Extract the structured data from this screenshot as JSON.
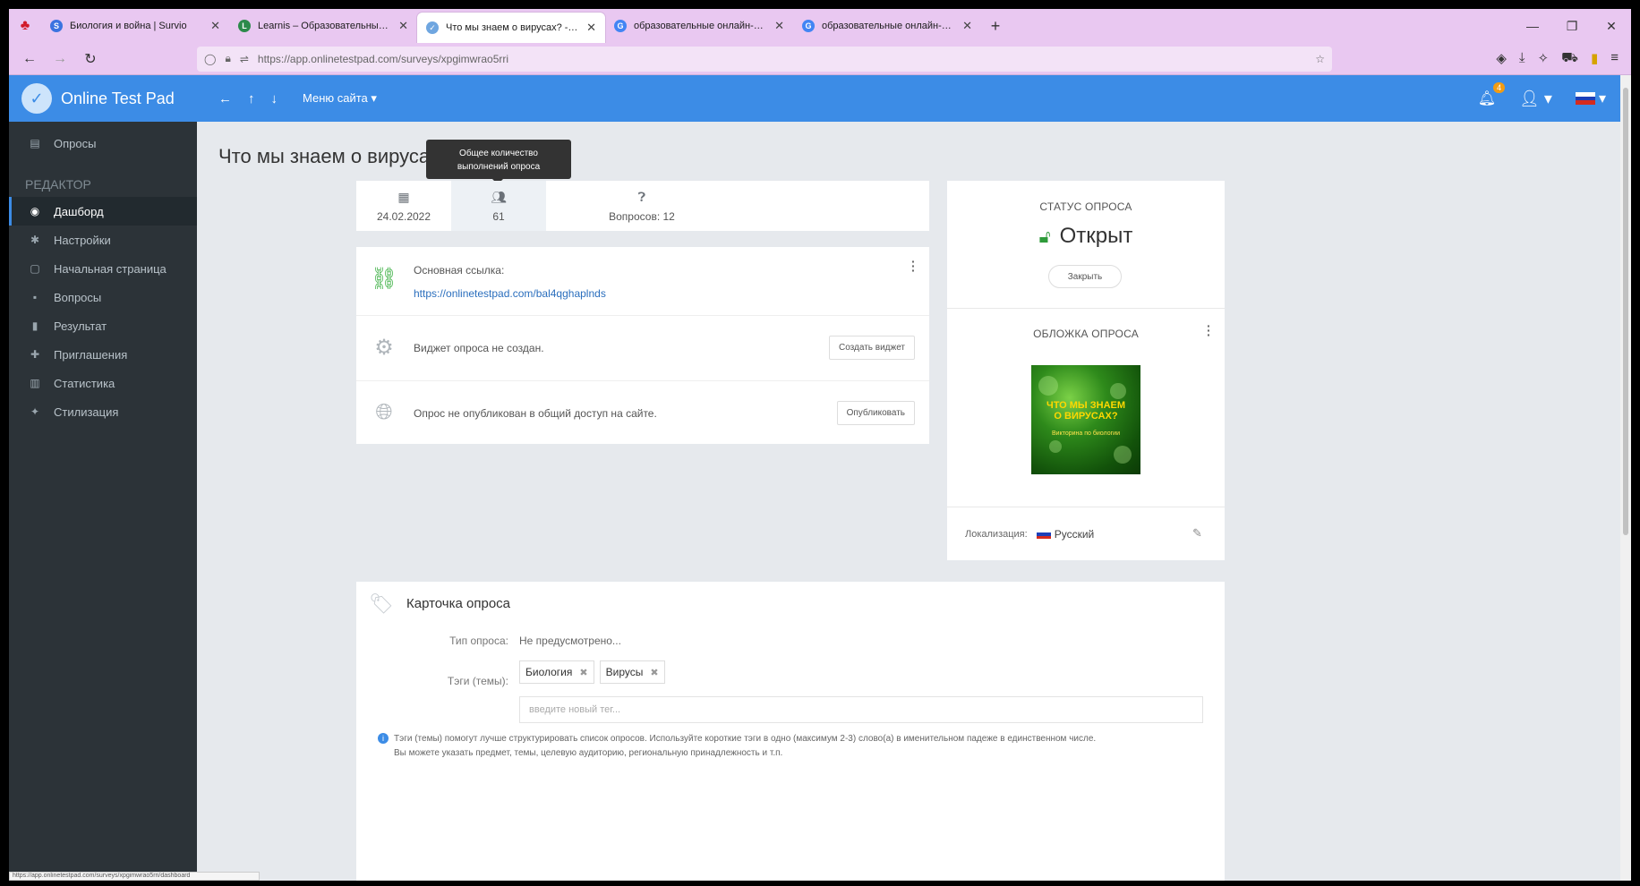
{
  "browser": {
    "tabs": [
      {
        "title": "Биология и война | Survio",
        "favicon": "survio-icon",
        "color": "#3b73e0",
        "glyph": "S",
        "active": false
      },
      {
        "title": "Learnis – Образовательные сер",
        "favicon": "learnis-icon",
        "color": "#2c8a4b",
        "glyph": "L",
        "active": false
      },
      {
        "title": "Что мы знаем о вирусах? - On",
        "favicon": "onlinetestpad-icon",
        "color": "#6fa6e0",
        "glyph": "✓",
        "active": true
      },
      {
        "title": "образовательные онлайн-сер",
        "favicon": "google-icon",
        "color": "#4285f4",
        "glyph": "G",
        "active": false
      },
      {
        "title": "образовательные онлайн-сер",
        "favicon": "google-icon",
        "color": "#4285f4",
        "glyph": "G",
        "active": false
      }
    ],
    "url": "https://app.onlinetestpad.com/surveys/xpgimwrao5rri"
  },
  "header": {
    "brand": "Online Test Pad",
    "menu": "Меню сайта",
    "notifications": "4",
    "accent": "#3c8ce6"
  },
  "sidebar": {
    "top_item": "Опросы",
    "section": "РЕДАКТОР",
    "items": [
      {
        "label": "Дашборд",
        "icon": "dashboard-icon",
        "glyph": "◉"
      },
      {
        "label": "Настройки",
        "icon": "gear-icon",
        "glyph": "✱"
      },
      {
        "label": "Начальная страница",
        "icon": "page-icon",
        "glyph": "▢"
      },
      {
        "label": "Вопросы",
        "icon": "question-icon",
        "glyph": "▪"
      },
      {
        "label": "Результат",
        "icon": "results-icon",
        "glyph": "▮"
      },
      {
        "label": "Приглашения",
        "icon": "user-plus-icon",
        "glyph": "✚"
      },
      {
        "label": "Статистика",
        "icon": "chart-icon",
        "glyph": "▥"
      },
      {
        "label": "Стилизация",
        "icon": "paint-icon",
        "glyph": "✦"
      }
    ]
  },
  "page": {
    "title": "Что мы знаем о вирусах?",
    "tooltip_line1": "Общее количество",
    "tooltip_line2": "выполнений опроса"
  },
  "stats": {
    "date": "24.02.2022",
    "completions": "61",
    "questions": "Вопросов: 12"
  },
  "links": {
    "main_label": "Основная ссылка:",
    "main_url": "https://onlinetestpad.com/bal4qghaplnds",
    "widget_text": "Виджет опроса не создан.",
    "widget_button": "Создать виджет",
    "publish_text": "Опрос не опубликован в общий доступ на сайте.",
    "publish_button": "Опубликовать"
  },
  "status": {
    "label": "СТАТУС ОПРОСА",
    "value": "Открыт",
    "close_button": "Закрыть",
    "cover_label": "ОБЛОЖКА ОПРОСА",
    "cover_title_line1": "ЧТО МЫ ЗНАЕМ",
    "cover_title_line2": "О ВИРУСАХ?",
    "cover_subtitle": "Викторина по биологии",
    "locale_label": "Локализация:",
    "locale_value": "Русский"
  },
  "survey_card": {
    "title": "Карточка опроса",
    "type_label": "Тип опроса:",
    "type_value": "Не предусмотрено...",
    "tags_label": "Тэги (темы):",
    "tags": [
      "Биология",
      "Вирусы"
    ],
    "tag_placeholder": "введите новый тег...",
    "hint_line1": "Тэги (темы) помогут лучше структурировать список опросов. Используйте короткие тэги в одно (максимум 2-3) слово(а) в именительном падеже в единственном числе.",
    "hint_line2": "Вы можете указать предмет, темы, целевую аудиторию, региональную принадлежность и т.п."
  },
  "status_tip": "https://app.onlinetestpad.com/surveys/xpgimwrao5rri/dashboard"
}
